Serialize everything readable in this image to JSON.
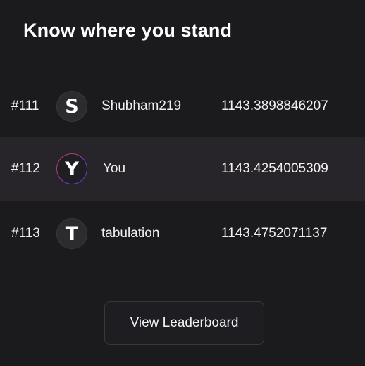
{
  "header": {
    "title": "Know where you stand"
  },
  "leaderboard": {
    "rows": [
      {
        "rank": "#111",
        "initial": "S",
        "name": "Shubham219",
        "score": "1143.3898846207",
        "is_you": false
      },
      {
        "rank": "#112",
        "initial": "Y",
        "name": "You",
        "score": "1143.4254005309",
        "is_you": true
      },
      {
        "rank": "#113",
        "initial": "T",
        "name": "tabulation",
        "score": "1143.4752071137",
        "is_you": false
      }
    ]
  },
  "footer": {
    "button_label": "View Leaderboard"
  },
  "colors": {
    "background": "#1b1a1d",
    "highlight_row": "#272529",
    "gradient_start": "#d8323f",
    "gradient_end": "#3b4fe6"
  }
}
